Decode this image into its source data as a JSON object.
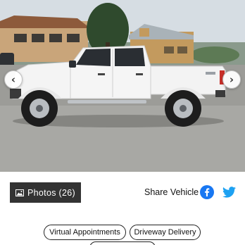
{
  "gallery": {
    "prev_icon": "chevron-left-icon",
    "next_icon": "chevron-right-icon",
    "prev_glyph": "‹",
    "next_glyph": "›",
    "photos_label": "Photos (26)",
    "photos_icon": "image-icon"
  },
  "share": {
    "label": "Share Vehicle",
    "facebook_icon": "facebook-icon",
    "twitter_icon": "twitter-icon",
    "facebook_color": "#1877f2",
    "twitter_color": "#1da1f2"
  },
  "features": {
    "items": [
      "Virtual Appointments",
      "Driveway Delivery"
    ]
  },
  "colors": {
    "photos_button_bg": "#333333",
    "truck_body": "#f7f7f7"
  }
}
